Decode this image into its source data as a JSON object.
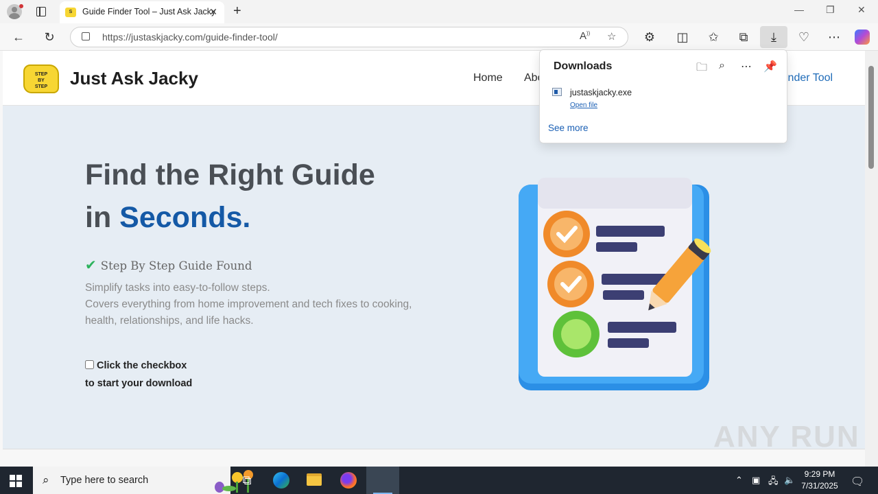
{
  "browser": {
    "tab_title": "Guide Finder Tool – Just Ask Jacky",
    "url": "https://justaskjacky.com/guide-finder-tool/"
  },
  "site": {
    "logo_text": "STEP BY STEP",
    "name": "Just Ask Jacky",
    "nav": {
      "home": "Home",
      "about": "Abo",
      "active": "inder Tool"
    }
  },
  "hero": {
    "title_line1": "Find the Right Guide",
    "title_line2_prefix": "in ",
    "title_line2_accent": "Seconds",
    "title_line2_suffix": ".",
    "found_label": "Step By Step Guide Found",
    "desc_line1": "Simplify tasks into easy-to-follow steps.",
    "desc_line2": "Covers everything from home improvement and tech fixes to cooking, health, relationships, and life hacks.",
    "checkbox_label": "Click the checkbox",
    "checkbox_sub": "to start your download"
  },
  "downloads": {
    "title": "Downloads",
    "file_name": "justaskjacky.exe",
    "open_file": "Open file",
    "see_more": "See more"
  },
  "taskbar": {
    "search_placeholder": "Type here to search",
    "time": "9:29 PM",
    "date": "7/31/2025"
  },
  "watermark": "ANY RUN"
}
